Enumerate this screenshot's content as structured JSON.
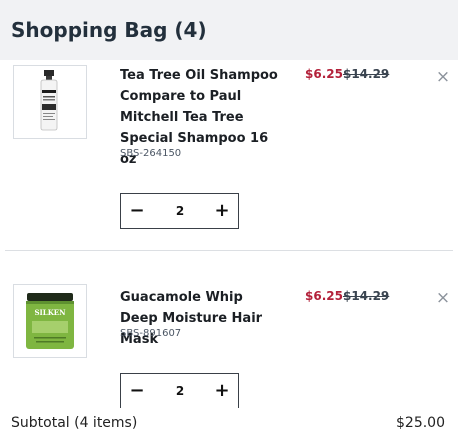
{
  "header": {
    "title": "Shopping Bag (4)"
  },
  "items": [
    {
      "name": "Tea Tree Oil Shampoo Compare to Paul Mitchell Tea Tree Special Shampoo 16 oz",
      "sku": "SBS-264150",
      "sale_price": "$6.25",
      "original_price": "$14.29",
      "quantity": "2",
      "minus_label": "−",
      "plus_label": "+",
      "remove_label": "×",
      "image_icon": "shampoo-bottle-icon"
    },
    {
      "name": "Guacamole Whip Deep Moisture Hair Mask",
      "sku": "SBS-891607",
      "sale_price": "$6.25",
      "original_price": "$14.29",
      "quantity": "2",
      "minus_label": "−",
      "plus_label": "+",
      "remove_label": "×",
      "image_icon": "hair-mask-jar-icon",
      "image_brand_text": "SILKEN"
    }
  ],
  "footer": {
    "subtotal_label": "Subtotal (4 items)",
    "subtotal_value": "$25.00"
  },
  "colors": {
    "header_bg": "#f1f2f4",
    "sale_price": "#b3213a",
    "jar_green": "#7fb641"
  }
}
